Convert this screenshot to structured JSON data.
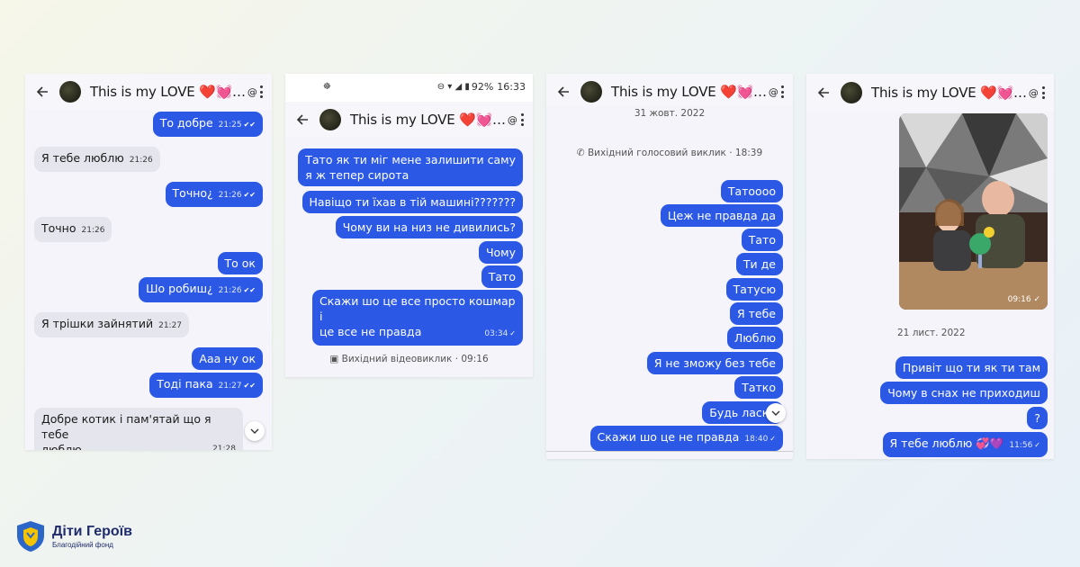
{
  "screen1": {
    "title": "This is my LOVE ❤️💓…",
    "messages": [
      {
        "text": "То добре",
        "time": "21:25",
        "dir": "out"
      },
      {
        "text": "Я тебе люблю",
        "time": "21:26",
        "dir": "in"
      },
      {
        "text": "Точно¿",
        "time": "21:26",
        "dir": "out"
      },
      {
        "text": "Точно",
        "time": "21:26",
        "dir": "in"
      },
      {
        "text": "То ок",
        "dir": "out"
      },
      {
        "text": "Шо робиш¿",
        "time": "21:26",
        "dir": "out"
      },
      {
        "text": "Я трішки зайнятий",
        "time": "21:27",
        "dir": "in"
      },
      {
        "text": "Ааа ну ок",
        "dir": "out"
      },
      {
        "text": "Тоді пака",
        "time": "21:27",
        "dir": "out"
      },
      {
        "text_line1": "Добре котик і пам'ятай що я тебе",
        "text_line2": "люблю",
        "time": "21:28",
        "dir": "in"
      }
    ]
  },
  "screen2": {
    "status_time": "16:33",
    "battery": "92%",
    "title": "This is my LOVE ❤️💓…",
    "messages": [
      {
        "text_line1": "Тато як ти міг мене залишити саму",
        "text_line2": "я ж тепер сирота",
        "dir": "out"
      },
      {
        "text": "Навіщо ти їхав в тій машині???????",
        "dir": "out"
      },
      {
        "text": "Чому ви на низ не дивились?",
        "dir": "out"
      },
      {
        "text": "Чому",
        "dir": "out"
      },
      {
        "text": "Тато",
        "dir": "out"
      },
      {
        "text_line1": "Скажи шо це все просто кошмар і",
        "text_line2": "це все не правда",
        "time": "03:34",
        "dir": "out"
      }
    ],
    "call": "Вихідний відеовиклик · 09:16"
  },
  "screen3": {
    "title": "This is my LOVE ❤️💓…",
    "date": "31 жовт. 2022",
    "call": "Вихідний голосовий виклик · 18:39",
    "messages": [
      {
        "text": "Татоооо",
        "dir": "out"
      },
      {
        "text": "Цеж не правда да",
        "dir": "out"
      },
      {
        "text": "Тато",
        "dir": "out"
      },
      {
        "text": "Ти де",
        "dir": "out"
      },
      {
        "text": "Татусю",
        "dir": "out"
      },
      {
        "text": "Я тебе",
        "dir": "out"
      },
      {
        "text": "Люблю",
        "dir": "out"
      },
      {
        "text": "Я не зможу без тебе",
        "dir": "out"
      },
      {
        "text": "Татко",
        "dir": "out"
      },
      {
        "text": "Будь ласка",
        "dir": "out"
      },
      {
        "text": "Скажи шо це не правда",
        "time": "18:40",
        "dir": "out"
      }
    ]
  },
  "screen4": {
    "title": "This is my LOVE ❤️💓…",
    "photo_time": "09:16",
    "date": "21 лист. 2022",
    "messages": [
      {
        "text": "Привіт що ти як ти там",
        "dir": "out"
      },
      {
        "text": "Чому в снах не приходиш",
        "dir": "out"
      },
      {
        "text": "?",
        "dir": "out"
      },
      {
        "text": "Я тебе люблю 💞💜",
        "time": "11:56",
        "dir": "out"
      }
    ]
  },
  "brand": {
    "name": "Діти Героїв",
    "subtitle": "Благодійний фонд",
    "colors": {
      "shield_blue": "#2b66c9",
      "shield_yellow": "#f5c400",
      "text": "#1f2b6b"
    }
  },
  "colors": {
    "bubble_out": "#2b59e6",
    "bubble_in": "#e5e6ed",
    "chat_bg": "#f4f4fa"
  }
}
